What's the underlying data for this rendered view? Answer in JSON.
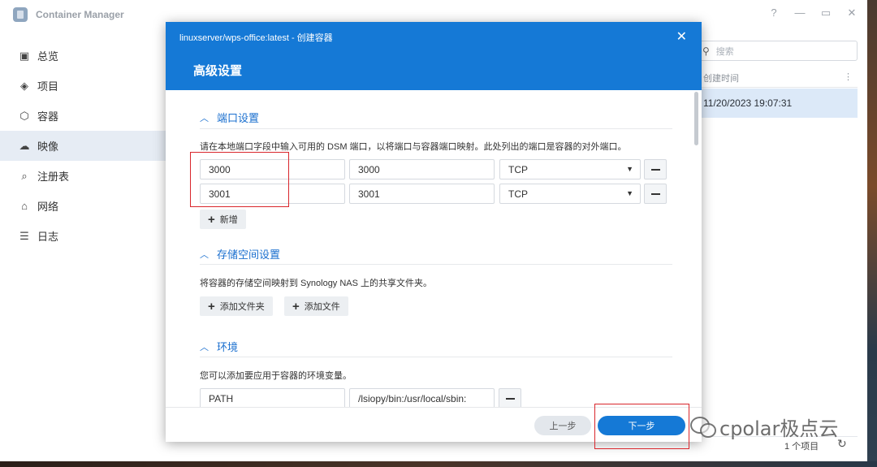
{
  "window": {
    "title": "Container Manager",
    "controls": {
      "help": "?",
      "minimize": "—",
      "maximize": "▭",
      "close": "✕"
    }
  },
  "sidebar": {
    "items": [
      {
        "label": "总览",
        "icon": "overview-icon",
        "glyph": "▣"
      },
      {
        "label": "项目",
        "icon": "project-icon",
        "glyph": "◈"
      },
      {
        "label": "容器",
        "icon": "container-icon",
        "glyph": "⬡"
      },
      {
        "label": "映像",
        "icon": "image-cloud-icon",
        "glyph": "☁"
      },
      {
        "label": "注册表",
        "icon": "registry-search-icon",
        "glyph": "⌕"
      },
      {
        "label": "网络",
        "icon": "network-icon",
        "glyph": "⌂"
      },
      {
        "label": "日志",
        "icon": "log-list-icon",
        "glyph": "☰"
      }
    ],
    "active_index": 3
  },
  "list": {
    "search_placeholder": "搜索",
    "column_header": "创建时间",
    "selected_row_time": "11/20/2023 19:07:31",
    "item_count": "1 个项目"
  },
  "dialog": {
    "title": "linuxserver/wps-office:latest - 创建容器",
    "close": "✕",
    "heading": "高级设置",
    "ports": {
      "section_title": "端口设置",
      "description": "请在本地端口字段中输入可用的 DSM 端口，以将端口与容器端口映射。此处列出的端口是容器的对外端口。",
      "rows": [
        {
          "local": "3000",
          "container": "3000",
          "protocol": "TCP"
        },
        {
          "local": "3001",
          "container": "3001",
          "protocol": "TCP"
        }
      ],
      "add_label": "新增"
    },
    "storage": {
      "section_title": "存储空间设置",
      "description": "将容器的存储空间映射到 Synology NAS 上的共享文件夹。",
      "add_folder_label": "添加文件夹",
      "add_file_label": "添加文件"
    },
    "env": {
      "section_title": "环境",
      "description": "您可以添加要应用于容器的环境变量。",
      "rows": [
        {
          "name": "PATH",
          "value": "/lsiopy/bin:/usr/local/sbin:"
        }
      ]
    },
    "footer": {
      "prev_label": "上一步",
      "next_label": "下一步"
    }
  },
  "watermark": "cpolar极点云",
  "colors": {
    "accent": "#1579d6",
    "highlight_box": "#d9262c",
    "sidebar_active": "#e6ecf4",
    "selected_row": "#dce9f8"
  }
}
